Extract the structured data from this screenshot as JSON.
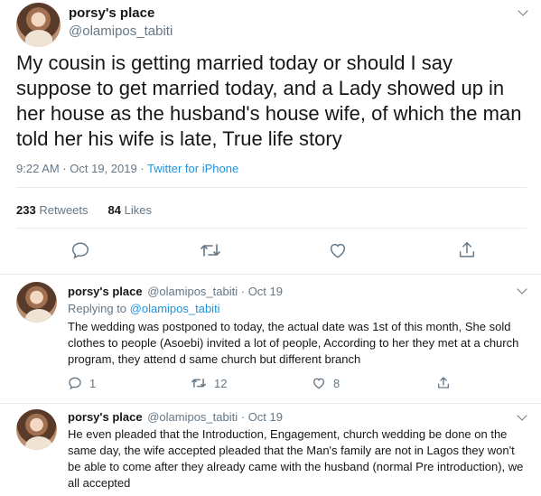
{
  "main_tweet": {
    "display_name": "porsy's place",
    "handle": "@olamipos_tabiti",
    "text": "My cousin is getting married today or should I say suppose to get married today, and a Lady showed up in her house as the husband's house wife, of which the man told her his wife is late, True life story",
    "time": "9:22 AM · Oct 19, 2019 · ",
    "source": "Twitter for iPhone",
    "retweets_count": "233",
    "retweets_label": "Retweets",
    "likes_count": "84",
    "likes_label": "Likes",
    "actions": {
      "reply_icon": "reply-icon",
      "retweet_icon": "retweet-icon",
      "like_icon": "heart-icon",
      "share_icon": "share-icon"
    }
  },
  "replies": [
    {
      "display_name": "porsy's place",
      "handle": "@olamipos_tabiti",
      "date": "· Oct 19",
      "replying_prefix": "Replying to ",
      "replying_to": "@olamipos_tabiti",
      "text": "The wedding was postponed to today, the actual date was 1st of this month, She sold clothes to people (Asoebi) invited a lot of people, According to her they met at a church program, they attend d same  church but different branch",
      "reply_count": "1",
      "retweet_count": "12",
      "like_count": "8"
    },
    {
      "display_name": "porsy's place",
      "handle": "@olamipos_tabiti",
      "date": "· Oct 19",
      "text": "He even pleaded that the Introduction, Engagement, church wedding be done on the same day, the wife accepted pleaded that the Man's family are not in Lagos they won't be able to come after they already came with the husband (normal Pre introduction), we all accepted"
    }
  ],
  "colors": {
    "accent": "#1b95e0",
    "secondary_text": "#657786",
    "border": "#e6ecf0"
  }
}
